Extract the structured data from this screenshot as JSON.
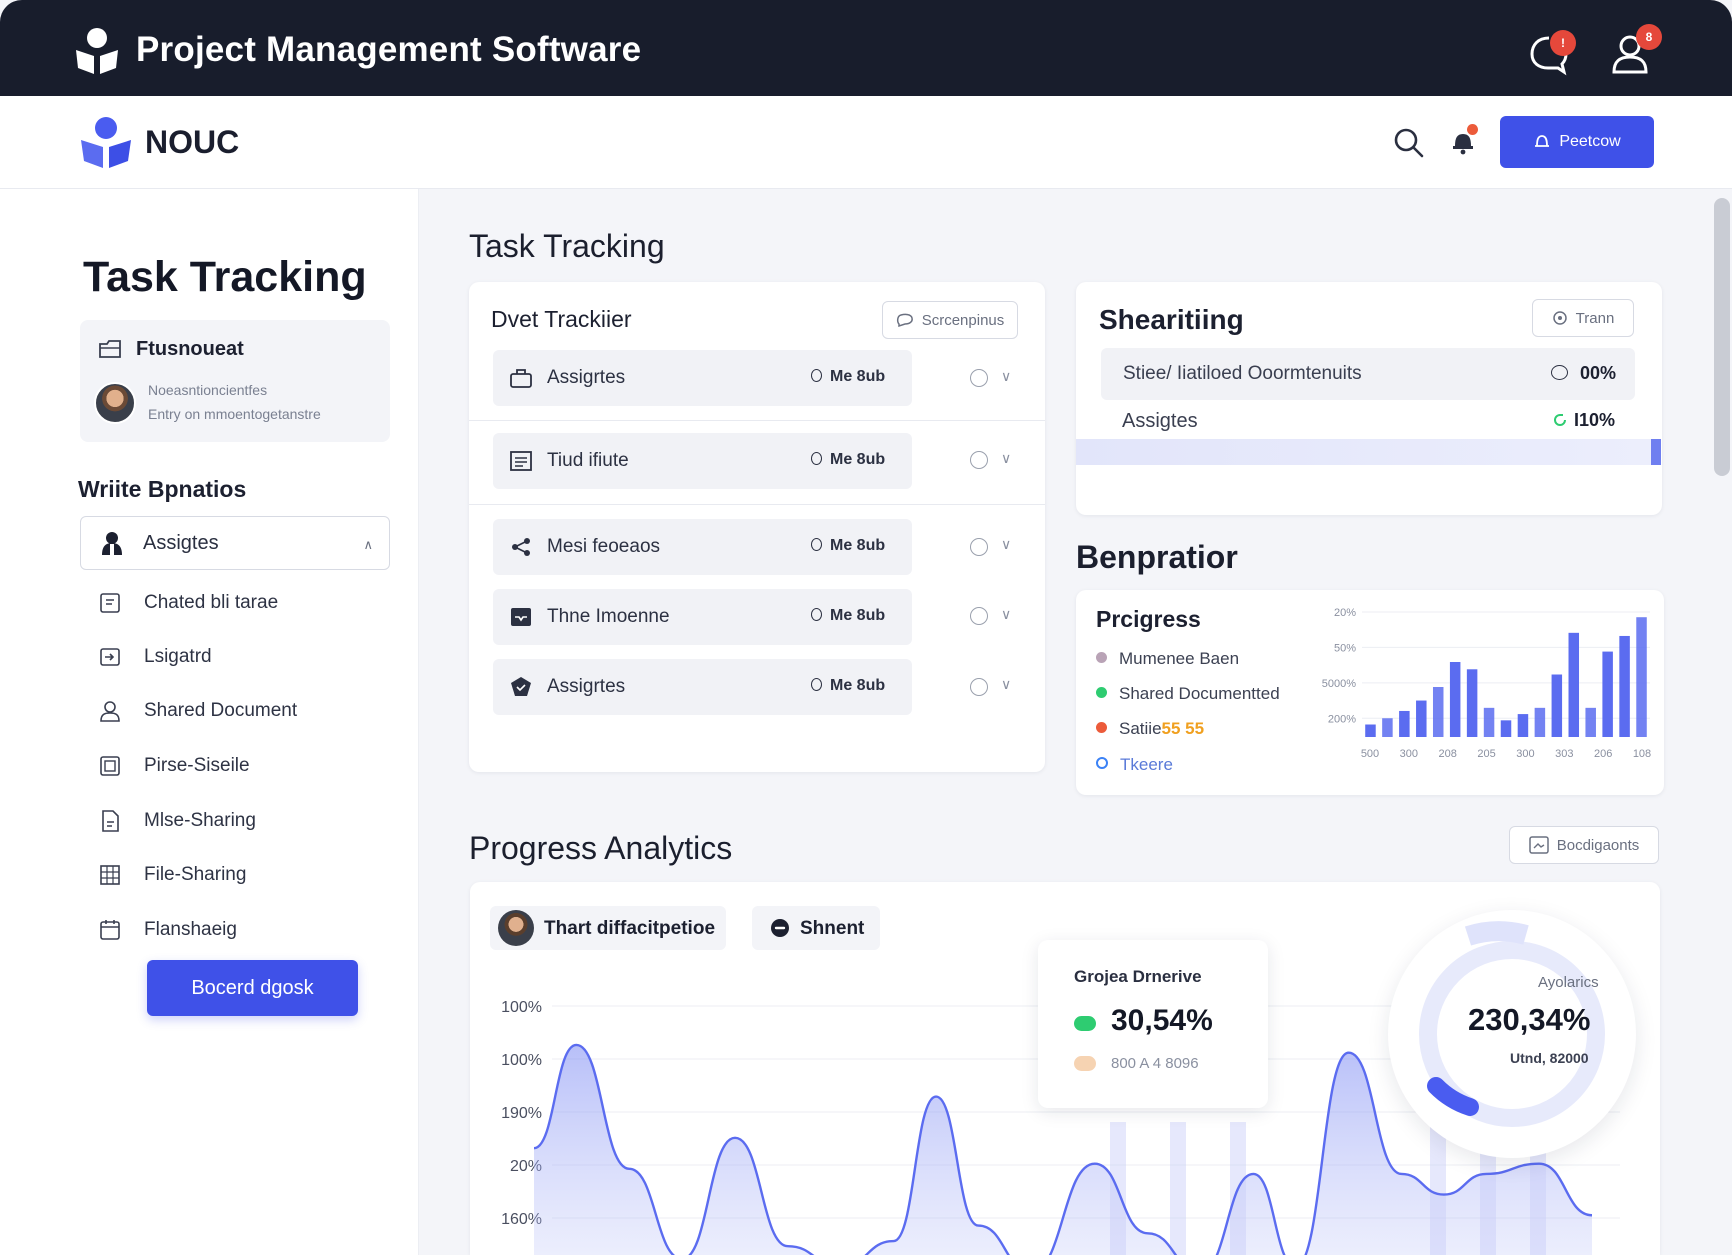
{
  "app": {
    "title": "Project Management Software",
    "notif_badge": "!",
    "user_badge": "8"
  },
  "header": {
    "brand": "NOUC",
    "action_label": "Рeetcow"
  },
  "sidebar": {
    "title": "Task Tracking",
    "card": {
      "title": "Ftusnoueat",
      "line1": "Noeasntioncientfes",
      "line2": "Entry on mmoentogetanstre"
    },
    "section_title": "Wriite Bpnatios",
    "select_value": "Assigtes",
    "items": [
      {
        "label": "Chated bli tarae",
        "icon": "chat-icon"
      },
      {
        "label": "Lsigatrd",
        "icon": "login-icon"
      },
      {
        "label": "Shared Document",
        "icon": "user-icon"
      },
      {
        "label": "Pirse-Siseile",
        "icon": "image-icon"
      },
      {
        "label": "Mlse-Sharing",
        "icon": "document-icon"
      },
      {
        "label": "File-Sharing",
        "icon": "grid-icon"
      },
      {
        "label": "Flanshaeig",
        "icon": "calendar-icon"
      }
    ],
    "cta_label": "Bocerd dgosk"
  },
  "main": {
    "task_tracking_title": "Task Tracking",
    "tracker": {
      "title": "Dvet Trackiier",
      "button_label": "Scrcenpinus",
      "rows": [
        {
          "label": "Assigrtes",
          "meta": "Me 8ub",
          "icon": "briefcase-icon"
        },
        {
          "label": "Tiud ifiute",
          "meta": "Me 8ub",
          "icon": "list-icon"
        },
        {
          "label": "Mesi feoeaos",
          "meta": "Me 8ub",
          "icon": "share-icon"
        },
        {
          "label": "Thne Imoenne",
          "meta": "Me 8ub",
          "icon": "inbox-icon"
        },
        {
          "label": "Assigrtes",
          "meta": "Me 8ub",
          "icon": "shield-icon"
        }
      ]
    },
    "sharing": {
      "title": "Shearitiing",
      "button_label": "Trann",
      "row1_label": "Stiee/ Iiatiloed Ooormtenuits",
      "row1_value": "00%",
      "row2_label": "Assigtes",
      "row2_value": "I10%"
    },
    "benefits_title": "Benpratior",
    "progress": {
      "title": "Prcigress",
      "legend": [
        {
          "label": "Mumenee Baen",
          "color": "#b9a3b6",
          "highlight": ""
        },
        {
          "label": "Shared Documentted",
          "color": "#2ecc71",
          "highlight": ""
        },
        {
          "label": "Satiie",
          "color": "#ec5b3a",
          "highlight": "55 55"
        },
        {
          "label": "Tkeere",
          "color": "#3b82f6",
          "highlight": ""
        }
      ]
    },
    "analytics_title": "Progress Analytics",
    "analytics_button": "Bocdigaonts",
    "chip1_label": "Thart diffacitpetioe",
    "chip2_label": "Shnent",
    "stat": {
      "title": "Grojea Drnerive",
      "value": "30,54%",
      "sub": "800 A 4 8096"
    },
    "donut": {
      "label": "Ayolarics",
      "value": "230,34%",
      "sub": "Utnd, 82000"
    }
  },
  "chart_data": [
    {
      "type": "bar",
      "title": "",
      "y_tick_labels": [
        "20%",
        "50%",
        "5000%",
        "200%"
      ],
      "x_tick_labels": [
        "500",
        "300",
        "208",
        "205",
        "300",
        "303",
        "206",
        "108"
      ],
      "series": [
        {
          "values": [
            12,
            18,
            25,
            35,
            48,
            72,
            65,
            28,
            16,
            22,
            28,
            60,
            100,
            28,
            82,
            97,
            115
          ]
        }
      ],
      "color": "#5b6cf0"
    },
    {
      "type": "area",
      "title": "",
      "y_tick_labels": [
        "100%",
        "100%",
        "190%",
        "20%",
        "160%"
      ],
      "x": [
        0,
        4,
        9,
        14,
        19,
        24,
        29,
        34,
        38,
        42,
        47,
        53,
        58,
        63,
        68,
        72,
        77,
        82,
        86,
        90,
        95,
        100
      ],
      "values": [
        48,
        88,
        40,
        5,
        52,
        10,
        2,
        12,
        68,
        18,
        0,
        42,
        15,
        0,
        38,
        2,
        85,
        38,
        30,
        38,
        42,
        22
      ],
      "color": "#5b6cf0"
    }
  ]
}
